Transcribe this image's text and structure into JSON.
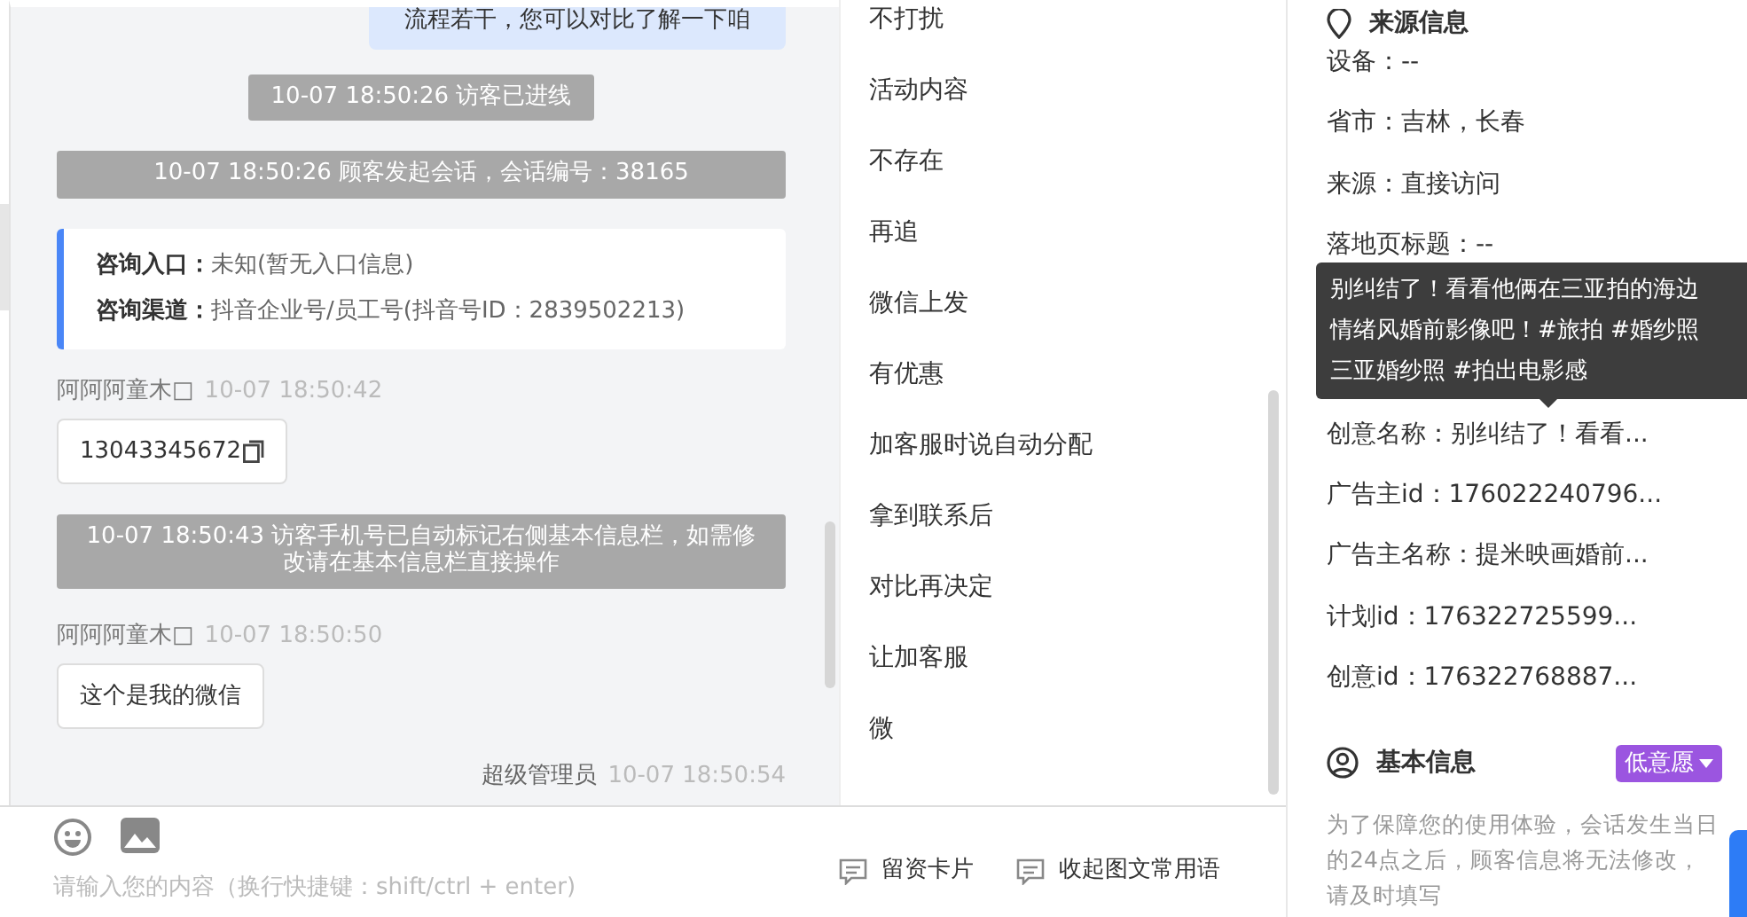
{
  "chat": {
    "messages": [
      {
        "kind": "agent_bubble",
        "text": "流程若干，您可以对比了解一下咱"
      },
      {
        "kind": "system",
        "text": "10-07 18:50:26 访客已进线"
      },
      {
        "kind": "system",
        "text": "10-07 18:50:26 顾客发起会话，会话编号：38165"
      },
      {
        "kind": "info_card",
        "lines": [
          {
            "label": "咨询入口：",
            "value": "未知(暂无入口信息)"
          },
          {
            "label": "咨询渠道：",
            "value": "抖音企业号/员工号(抖音号ID：2839502213)"
          }
        ]
      },
      {
        "kind": "visitor",
        "sender": "阿阿阿童木□",
        "time": "10-07 18:50:42",
        "text": "13043345672",
        "copy": true
      },
      {
        "kind": "system",
        "text": "10-07 18:50:43 访客手机号已自动标记右侧基本信息栏，如需修改请在基本信息栏直接操作"
      },
      {
        "kind": "visitor",
        "sender": "阿阿阿童木□",
        "time": "10-07 18:50:50",
        "text": "这个是我的微信",
        "copy": false
      },
      {
        "kind": "agent_header",
        "sender": "超级管理员",
        "time": "10-07 18:50:54"
      }
    ],
    "input": {
      "placeholder": "请输入您的内容（换行快捷键：shift/ctrl + enter)"
    }
  },
  "phrases": {
    "items": [
      "不打扰",
      "活动内容",
      "不存在",
      "再追",
      "微信上发",
      "有优惠",
      "加客服时说自动分配",
      "拿到联系后",
      "对比再决定",
      "让加客服",
      "微"
    ],
    "actions": [
      "留资卡片",
      "收起图文常用语"
    ]
  },
  "source_info": {
    "title": "来源信息",
    "fields": [
      "设备：--",
      "省市：吉林，长春",
      "来源：直接访问",
      "落地页标题：--",
      "创意名称：别纠结了！看看...",
      "广告主id：176022240796...",
      "广告主名称：提米映画婚前...",
      "计划id：176322725599...",
      "创意id：176322768887..."
    ],
    "tooltip": [
      "别纠结了！看看他俩在三亚拍的海边",
      "情绪风婚前影像吧！#旅拍 #婚纱照",
      "三亚婚纱照 #拍出电影感"
    ]
  },
  "basic_info": {
    "title": "基本信息",
    "intent_tag": "低意愿",
    "note": "为了保障您的使用体验，会话发生当日的24点之后，顾客信息将无法修改，请及时填写"
  }
}
